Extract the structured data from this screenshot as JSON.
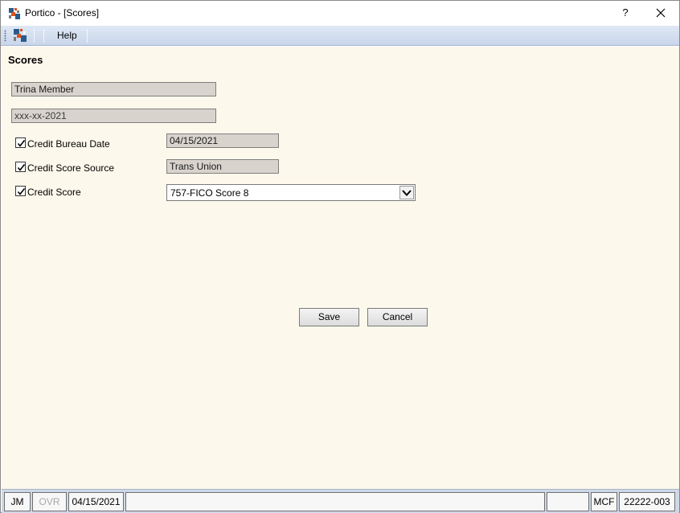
{
  "window": {
    "title": "Portico - [Scores]",
    "help_glyph": "?"
  },
  "menu": {
    "help_label": "Help"
  },
  "form": {
    "heading": "Scores",
    "member_name": "Trina Member",
    "ssn": "xxx-xx-2021",
    "rows": [
      {
        "label": "Credit Bureau Date",
        "checked": true,
        "value": "04/15/2021"
      },
      {
        "label": "Credit Score Source",
        "checked": true,
        "value": "Trans Union"
      },
      {
        "label": "Credit Score",
        "checked": true,
        "value": "757-FICO Score 8"
      }
    ],
    "save_label": "Save",
    "cancel_label": "Cancel"
  },
  "status": {
    "user": "JM",
    "ovr": "OVR",
    "date": "04/15/2021",
    "message": "",
    "blank": "",
    "branch": "MCF",
    "station": "22222-003"
  },
  "icons": {
    "app": "portico-logo-icon",
    "close": "close-icon",
    "dropdown": "chevron-down-icon",
    "check": "checkmark-icon"
  },
  "colors": {
    "content_bg": "#fdf8ec",
    "readonly_field": "#d8d3cd",
    "menubar": "#c9d6ea",
    "statusbar": "#cfd8e8"
  }
}
